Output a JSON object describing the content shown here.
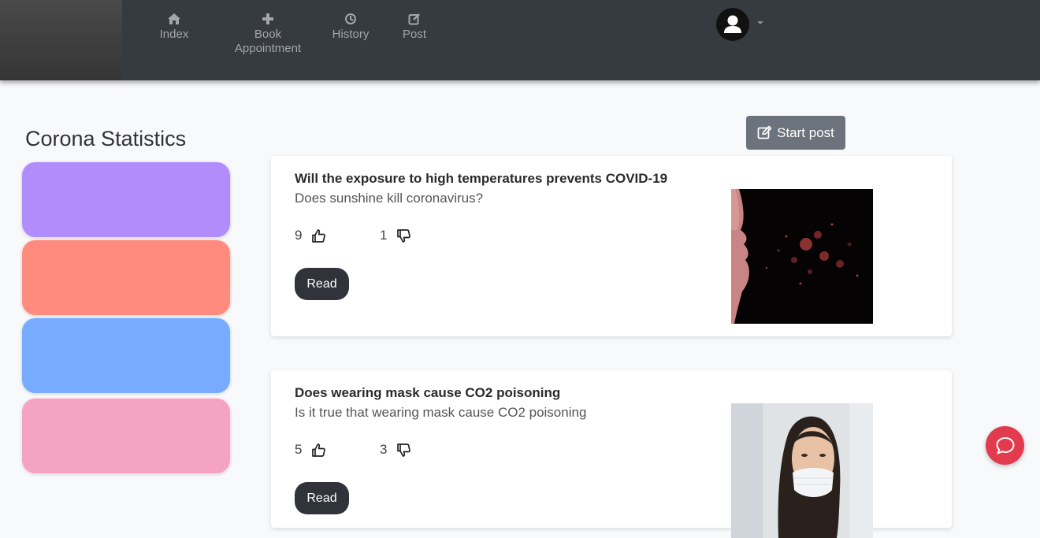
{
  "nav": {
    "items": [
      {
        "label": "Index",
        "icon": "home-icon"
      },
      {
        "label": "Book Appointment",
        "icon": "plus-icon"
      },
      {
        "label": "History",
        "icon": "history-icon"
      },
      {
        "label": "Post",
        "icon": "edit-icon"
      }
    ]
  },
  "sidebar": {
    "title": "Corona Statistics",
    "cards": [
      {
        "color": "#b18cfb"
      },
      {
        "color": "#ff8a7e"
      },
      {
        "color": "#78aaff"
      },
      {
        "color": "#f4a3c2"
      }
    ]
  },
  "start_post": {
    "label": "Start post"
  },
  "posts": [
    {
      "title": "Will the exposure to high temperatures prevents COVID-19",
      "subtitle": "Does sunshine kill coronavirus?",
      "likes": "9",
      "dislikes": "1",
      "read_label": "Read"
    },
    {
      "title": "Does wearing mask cause CO2 poisoning",
      "subtitle": "Is it true that wearing mask cause CO2 poisoning",
      "likes": "5",
      "dislikes": "3",
      "read_label": "Read"
    }
  ],
  "colors": {
    "navbar": "#363a41",
    "start_post_button": "#6c737c",
    "read_button": "#30333a",
    "chat_bubble": "#e23b4e"
  }
}
